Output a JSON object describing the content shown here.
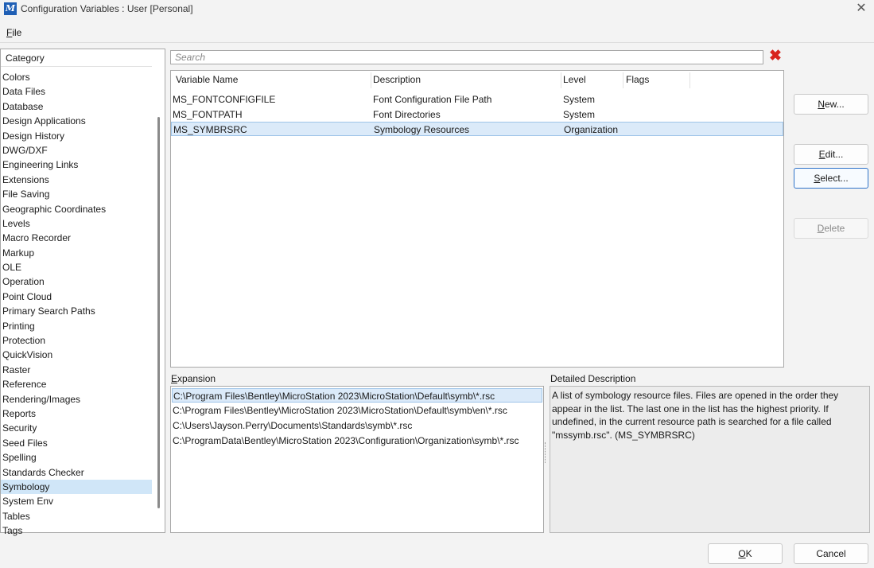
{
  "window": {
    "title": "Configuration Variables : User [Personal]",
    "app_icon_letter": "M",
    "close_glyph": "✕"
  },
  "menu": {
    "file_prefix": "",
    "file_underline": "F",
    "file_rest": "ile"
  },
  "category": {
    "header": "Category",
    "items": [
      "Colors",
      "Data Files",
      "Database",
      "Design Applications",
      "Design History",
      "DWG/DXF",
      "Engineering Links",
      "Extensions",
      "File Saving",
      "Geographic Coordinates",
      "Levels",
      "Macro Recorder",
      "Markup",
      "OLE",
      "Operation",
      "Point Cloud",
      "Primary Search Paths",
      "Printing",
      "Protection",
      "QuickVision",
      "Raster",
      "Reference",
      "Rendering/Images",
      "Reports",
      "Security",
      "Seed Files",
      "Spelling",
      "Standards Checker",
      "Symbology",
      "System Env",
      "Tables",
      "Tags"
    ],
    "selected_index": 28
  },
  "search": {
    "placeholder": "Search",
    "value": "",
    "clear_glyph": "✖"
  },
  "variables": {
    "columns": {
      "name": "Variable Name",
      "description": "Description",
      "level": "Level",
      "flags": "Flags"
    },
    "rows": [
      {
        "name": "MS_FONTCONFIGFILE",
        "description": "Font Configuration File Path",
        "level": "System",
        "flags": ""
      },
      {
        "name": "MS_FONTPATH",
        "description": "Font Directories",
        "level": "System",
        "flags": ""
      },
      {
        "name": "MS_SYMBRSRC",
        "description": "Symbology Resources",
        "level": "Organization",
        "flags": ""
      }
    ],
    "selected_index": 2
  },
  "buttons": {
    "new": {
      "pre": "",
      "u": "N",
      "post": "ew..."
    },
    "edit": {
      "pre": "",
      "u": "E",
      "post": "dit..."
    },
    "select": {
      "pre": "",
      "u": "S",
      "post": "elect..."
    },
    "delete": {
      "pre": "",
      "u": "D",
      "post": "elete"
    },
    "ok": {
      "pre": "",
      "u": "O",
      "post": "K"
    },
    "cancel": {
      "pre": "Cancel",
      "u": "",
      "post": ""
    }
  },
  "expansion": {
    "label_underline": "E",
    "label_rest": "xpansion",
    "items": [
      "C:\\Program Files\\Bentley\\MicroStation 2023\\MicroStation\\Default\\symb\\*.rsc",
      "C:\\Program Files\\Bentley\\MicroStation 2023\\MicroStation\\Default\\symb\\en\\*.rsc",
      "C:\\Users\\Jayson.Perry\\Documents\\Standards\\symb\\*.rsc",
      "C:\\ProgramData\\Bentley\\MicroStation 2023\\Configuration\\Organization\\symb\\*.rsc"
    ],
    "selected_index": 0
  },
  "detailed_description": {
    "label": "Detailed Description",
    "text": "A list of symbology resource files.  Files are opened in the order they appear in the list.  The last one in the list has the highest priority. If undefined, in the current resource path is searched for a file called \"mssymb.rsc\".  (MS_SYMBRSRC)"
  }
}
